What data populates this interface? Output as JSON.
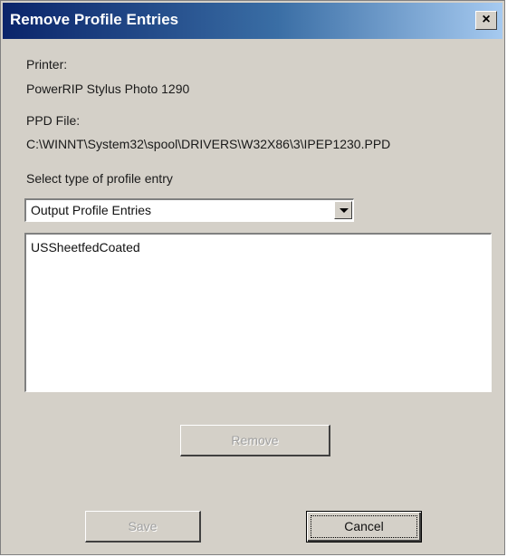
{
  "window": {
    "title": "Remove Profile Entries",
    "close_glyph": "×"
  },
  "printer": {
    "label": "Printer:",
    "value": "PowerRIP Stylus Photo 1290"
  },
  "ppd": {
    "label": "PPD File:",
    "value": "C:\\WINNT\\System32\\spool\\DRIVERS\\W32X86\\3\\IPEP1230.PPD"
  },
  "profile_type": {
    "label": "Select type of profile entry",
    "selected": "Output Profile Entries"
  },
  "entries": {
    "items": [
      "USSheetfedCoated"
    ]
  },
  "buttons": {
    "remove": "Remove",
    "save": "Save",
    "cancel": "Cancel"
  },
  "colors": {
    "title_gradient_start": "#0a246a",
    "title_gradient_end": "#a6caf0",
    "dialog_face": "#d4d0c8",
    "disabled_text": "#a0a0a0"
  }
}
